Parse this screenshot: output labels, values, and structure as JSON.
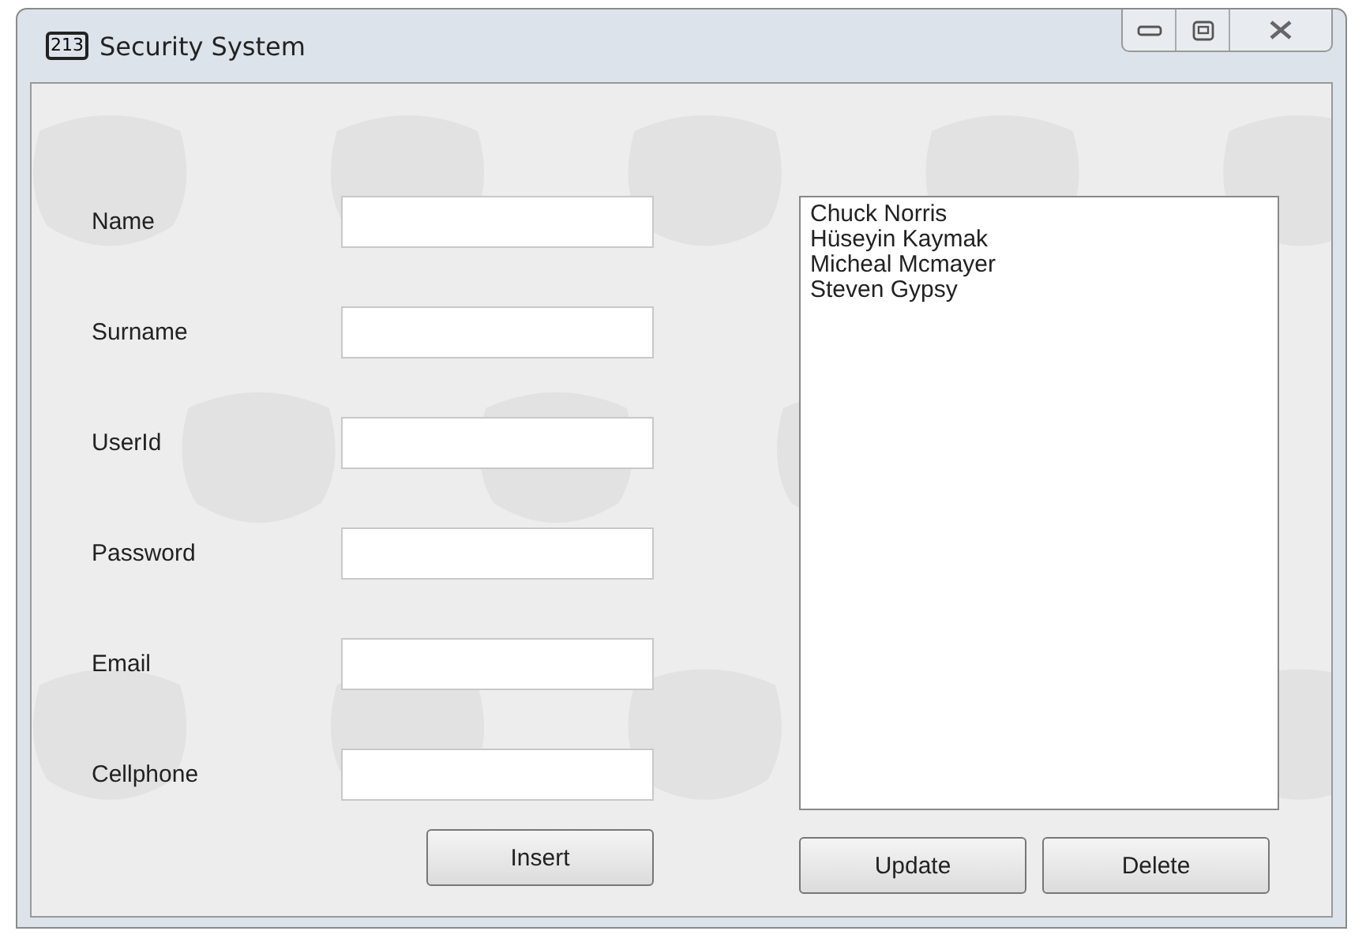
{
  "window": {
    "title": "Security System",
    "icon_label": "213"
  },
  "fields": [
    {
      "label": "Name"
    },
    {
      "label": "Surname"
    },
    {
      "label": "UserId"
    },
    {
      "label": "Password"
    },
    {
      "label": "Email"
    },
    {
      "label": "Cellphone"
    }
  ],
  "list": {
    "items": [
      "Chuck Norris",
      "Hüseyin Kaymak",
      "Micheal Mcmayer",
      "Steven Gypsy"
    ]
  },
  "buttons": {
    "left": [
      "Insert"
    ],
    "right": [
      "Update",
      "Delete"
    ]
  }
}
